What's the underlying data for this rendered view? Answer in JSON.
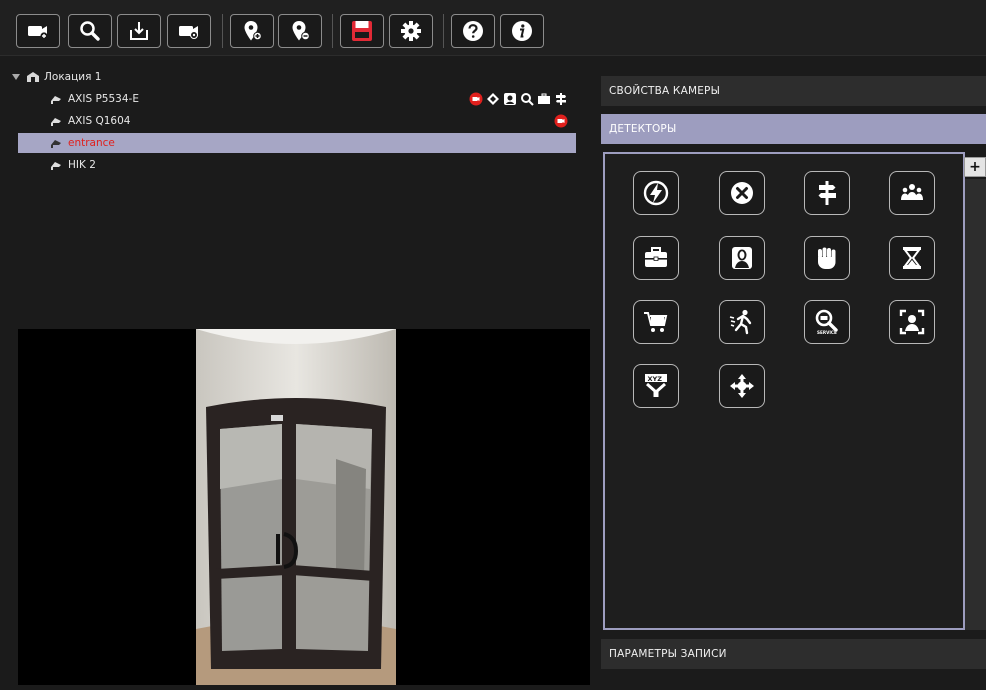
{
  "toolbar": {
    "buttons": [
      {
        "name": "add-camera",
        "icon": "camera-add-icon"
      },
      {
        "name": "search",
        "icon": "search-icon"
      },
      {
        "name": "import",
        "icon": "download-icon"
      },
      {
        "name": "camera-settings",
        "icon": "camera-settings-icon"
      },
      {
        "name": "add-location",
        "icon": "location-add-icon"
      },
      {
        "name": "remove-location",
        "icon": "location-remove-icon"
      },
      {
        "name": "save",
        "icon": "save-icon"
      },
      {
        "name": "settings",
        "icon": "gear-icon"
      },
      {
        "name": "help",
        "icon": "help-icon"
      },
      {
        "name": "info",
        "icon": "info-icon"
      }
    ],
    "accent_color": "#e22a36"
  },
  "tree": {
    "location": "Локация 1",
    "cameras": [
      {
        "label": "AXIS P5534-E",
        "selected": false
      },
      {
        "label": "AXIS Q1604",
        "selected": false
      },
      {
        "label": "entrance",
        "selected": true
      },
      {
        "label": "HIK 2",
        "selected": false
      }
    ]
  },
  "panels": {
    "camera_properties": "СВОЙСТВА КАМЕРЫ",
    "detectors": "ДЕТЕКТОРЫ",
    "recording_params": "ПАРАМЕТРЫ ЗАПИСИ",
    "add_label": "+"
  },
  "detectors": [
    {
      "icon": "lightning-icon"
    },
    {
      "icon": "close-circle-icon"
    },
    {
      "icon": "signpost-icon"
    },
    {
      "icon": "crowd-icon"
    },
    {
      "icon": "briefcase-icon"
    },
    {
      "icon": "face-icon"
    },
    {
      "icon": "fist-icon"
    },
    {
      "icon": "hourglass-icon"
    },
    {
      "icon": "cart-icon"
    },
    {
      "icon": "running-man-icon"
    },
    {
      "icon": "service-camera-icon",
      "caption": "SERVICE"
    },
    {
      "icon": "face-frame-icon"
    },
    {
      "icon": "plate-xyz-icon",
      "caption": "XYZ"
    },
    {
      "icon": "directions-icon"
    }
  ],
  "colors": {
    "selection": "#a6a6c5",
    "active_header": "#9d9dbf",
    "alert_red": "#e0201d"
  }
}
